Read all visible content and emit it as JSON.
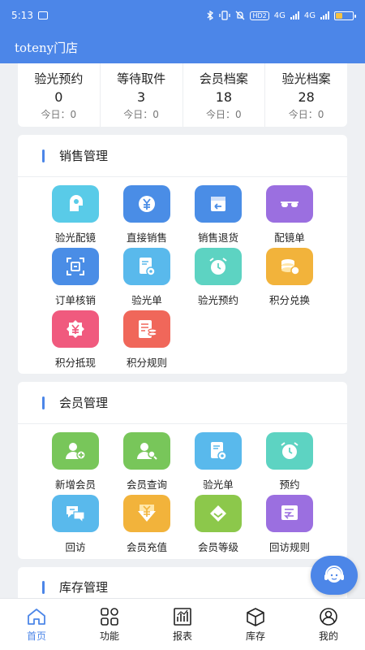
{
  "status_bar": {
    "time": "5:13",
    "network_badge": "HD2",
    "signal_label": "4G"
  },
  "header": {
    "title": "toteny门店"
  },
  "stats": [
    {
      "label": "验光预约",
      "value": "0",
      "today": "今日：0"
    },
    {
      "label": "等待取件",
      "value": "3",
      "today": "今日：0"
    },
    {
      "label": "会员档案",
      "value": "18",
      "today": "今日：0"
    },
    {
      "label": "验光档案",
      "value": "28",
      "today": "今日：0"
    }
  ],
  "sections": {
    "sales": {
      "title": "销售管理",
      "items": [
        {
          "label": "验光配镜",
          "icon": "eye-exam-icon",
          "color": "#59cbe8"
        },
        {
          "label": "直接销售",
          "icon": "yen-coin-icon",
          "color": "#4a8de6"
        },
        {
          "label": "销售退货",
          "icon": "return-box-icon",
          "color": "#4a8de6"
        },
        {
          "label": "配镜单",
          "icon": "glasses-icon",
          "color": "#9b6fe0"
        },
        {
          "label": "订单核销",
          "icon": "scan-frame-icon",
          "color": "#4a8de6"
        },
        {
          "label": "验光单",
          "icon": "eye-document-icon",
          "color": "#59b9ec"
        },
        {
          "label": "验光预约",
          "icon": "alarm-clock-icon",
          "color": "#5dd3c2"
        },
        {
          "label": "积分兑换",
          "icon": "coin-stack-icon",
          "color": "#f2b33b"
        },
        {
          "label": "积分抵现",
          "icon": "yen-badge-icon",
          "color": "#f05a7e"
        },
        {
          "label": "积分规则",
          "icon": "rules-document-icon",
          "color": "#f0675a"
        }
      ]
    },
    "members": {
      "title": "会员管理",
      "items": [
        {
          "label": "新增会员",
          "icon": "add-user-icon",
          "color": "#78c65a"
        },
        {
          "label": "会员查询",
          "icon": "search-user-icon",
          "color": "#78c65a"
        },
        {
          "label": "验光单",
          "icon": "eye-document-icon",
          "color": "#59b9ec"
        },
        {
          "label": "预约",
          "icon": "alarm-clock-icon",
          "color": "#5dd3c2"
        },
        {
          "label": "回访",
          "icon": "chat-bubbles-icon",
          "color": "#59b9ec"
        },
        {
          "label": "会员充值",
          "icon": "yen-download-icon",
          "color": "#f2b33b"
        },
        {
          "label": "会员等级",
          "icon": "diamond-icon",
          "color": "#8cc84b"
        },
        {
          "label": "回访规则",
          "icon": "rules-chat-icon",
          "color": "#9b6fe0"
        }
      ]
    },
    "inventory": {
      "title": "库存管理"
    }
  },
  "tabs": [
    {
      "label": "首页",
      "icon": "home-icon",
      "active": true
    },
    {
      "label": "功能",
      "icon": "grid-icon",
      "active": false
    },
    {
      "label": "报表",
      "icon": "report-icon",
      "active": false
    },
    {
      "label": "库存",
      "icon": "box-icon",
      "active": false
    },
    {
      "label": "我的",
      "icon": "user-icon",
      "active": false
    }
  ],
  "colors": {
    "primary": "#4c86e8",
    "background": "#eef0f3"
  }
}
